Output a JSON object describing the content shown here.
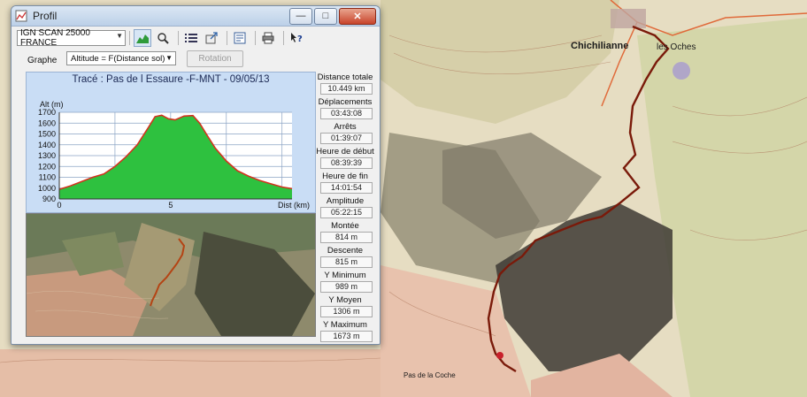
{
  "window": {
    "title": "Profil",
    "controls": {
      "minimize": "—",
      "maximize": "□",
      "close": "✕"
    }
  },
  "toolbar": {
    "map_select": "IGN SCAN 25000 FRANCE",
    "buttons": [
      "profile-icon",
      "zoom-icon",
      "list-icon",
      "export-icon",
      "map-icon",
      "print-icon",
      "help-icon"
    ]
  },
  "graphe": {
    "label": "Graphe",
    "selected": "Altitude = F(Distance sol)",
    "rotation_label": "Rotation"
  },
  "chart_data": {
    "type": "area",
    "title": "Tracé : Pas de l Essaure -F-MNT - 09/05/13",
    "ylabel": "Alt (m)",
    "xlabel": "Dist (km)",
    "ylim": [
      900,
      1700
    ],
    "xlim": [
      0,
      10.449
    ],
    "y_ticks": [
      "1700",
      "1600",
      "1500",
      "1400",
      "1300",
      "1200",
      "1100",
      "1000",
      "900"
    ],
    "x_ticks": [
      "0",
      "5"
    ],
    "grid": true,
    "fill_color": "#2ec13f",
    "line_color": "#d2331e",
    "x": [
      0,
      0.5,
      1,
      1.5,
      2,
      2.5,
      3,
      3.5,
      4,
      4.3,
      4.6,
      4.9,
      5.2,
      5.6,
      6,
      6.3,
      6.6,
      7,
      7.5,
      8,
      8.5,
      9,
      9.5,
      10,
      10.449
    ],
    "y": [
      989,
      1020,
      1060,
      1100,
      1130,
      1200,
      1290,
      1400,
      1560,
      1660,
      1673,
      1640,
      1630,
      1665,
      1670,
      1600,
      1500,
      1370,
      1250,
      1160,
      1110,
      1070,
      1040,
      1010,
      995
    ]
  },
  "stats": [
    {
      "label": "Distance totale",
      "value": "10.449 km"
    },
    {
      "label": "Déplacements",
      "value": "03:43:08"
    },
    {
      "label": "Arrêts",
      "value": "01:39:07"
    },
    {
      "label": "Heure de début",
      "value": "08:39:39"
    },
    {
      "label": "Heure de fin",
      "value": "14:01:54"
    },
    {
      "label": "Amplitude",
      "value": "05:22:15"
    },
    {
      "label": "Montée",
      "value": "814 m"
    },
    {
      "label": "Descente",
      "value": "815 m"
    },
    {
      "label": "Y Minimum",
      "value": "989 m"
    },
    {
      "label": "Y Moyen",
      "value": "1306 m"
    },
    {
      "label": "Y Maximum",
      "value": "1673 m"
    }
  ],
  "map": {
    "village_label": "Chichilianne",
    "place_label": "les Oches",
    "place_label_2": "Pas de la Coche",
    "trail_color": "#7a1a0a"
  }
}
